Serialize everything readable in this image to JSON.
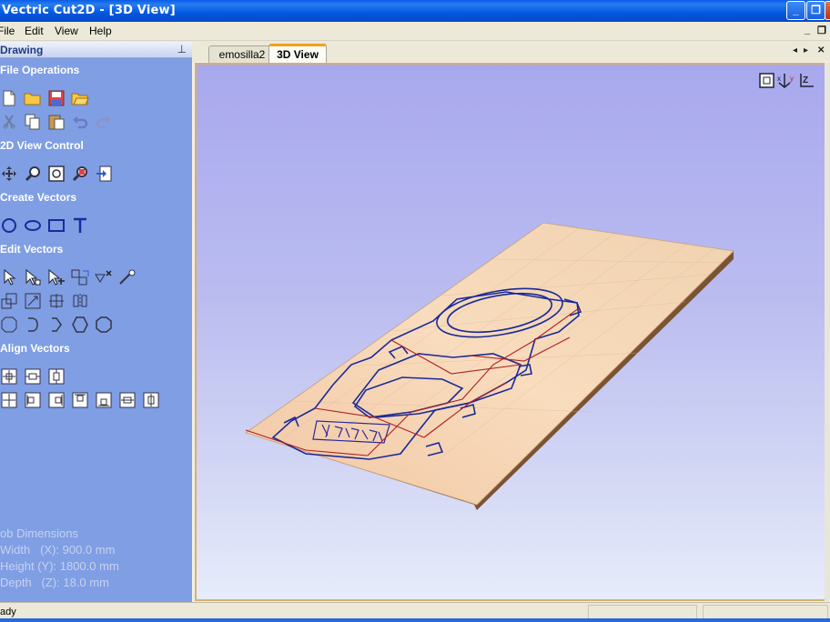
{
  "window": {
    "title": "Vectric Cut2D - [3D View]",
    "buttons": {
      "minimize": "_",
      "restore": "❐",
      "close": "✕"
    }
  },
  "menubar": {
    "items": [
      {
        "label": "File"
      },
      {
        "label": "Edit"
      },
      {
        "label": "View"
      },
      {
        "label": "Help"
      }
    ],
    "mdi_controls": {
      "minimize": "_",
      "restore": "❐"
    }
  },
  "sidebar": {
    "header": "Drawing",
    "pin": "🖈",
    "sections": {
      "file_operations": "File Operations",
      "view_control": "2D View Control",
      "create_vectors": "Create Vectors",
      "edit_vectors": "Edit Vectors",
      "align_vectors": "Align Vectors"
    },
    "job_dimensions": {
      "title": "ob Dimensions",
      "width": "Width   (X): 900.0 mm",
      "height": "Height (Y): 1800.0 mm",
      "depth": "Depth   (Z): 18.0 mm"
    }
  },
  "tabs": [
    {
      "label": "emosilla2",
      "active": false
    },
    {
      "label": "3D View",
      "active": true
    }
  ],
  "tab_nav": {
    "prev": "◂",
    "next": "▸",
    "close": "✕"
  },
  "view": {
    "tool_icons": [
      "zoom-extents-icon",
      "rotate-axes-icon",
      "z-axis-icon"
    ]
  },
  "status": {
    "text": "ady"
  },
  "colors": {
    "sidebar_bg": "#7f9ee4",
    "view_bg_top": "#a8a8ee",
    "view_bg_bottom": "#e6ecfa",
    "board_top": "#f6d8b8",
    "board_edge": "#6b4a2c",
    "vector_line": "#1a2a9a",
    "toolpath_line": "#b02020"
  }
}
